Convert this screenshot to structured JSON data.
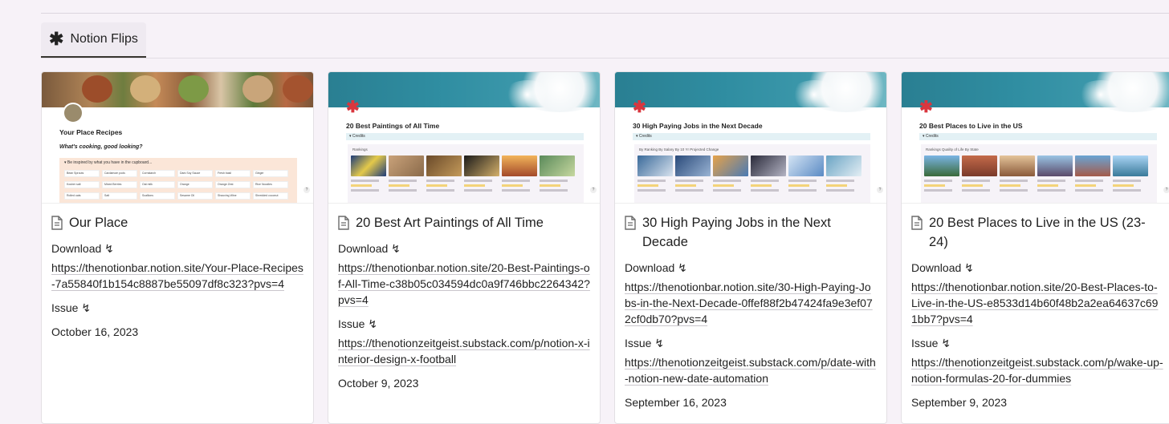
{
  "tab": {
    "icon": "asterisk-icon",
    "label": "Notion Flips"
  },
  "cards": [
    {
      "cover_type": "recipes",
      "cover_title": "Your Place Recipes",
      "cover_subtitle": "What's cooking, good looking?",
      "cover_box_title": "▾ Be inspired by what you have in the cupboard...",
      "cover_ingredients": [
        "Bean Sprouts",
        "Cardamom pods",
        "Cornstarch",
        "Dark Soy Sauce",
        "Fresh basil",
        "Ginger",
        "Kosher salt",
        "Mixed Berries",
        "Oat milk",
        "Orange",
        "Orange Zest",
        "Rice Noodles",
        "Rolled oats",
        "Salt",
        "Scallions",
        "Sesame Oil",
        "Shaoxing Wine",
        "Shredded coconut"
      ],
      "title": "Our Place",
      "download_label": "Download ↯",
      "download_url": "https://thenotionbar.notion.site/Your-Place-Recipes-7a55840f1b154c8887be55097df8c323?pvs=4",
      "issue_label": "Issue ↯",
      "issue_url": "",
      "date": "October 16, 2023"
    },
    {
      "cover_type": "database",
      "cover_title": "20 Best Paintings of All Time",
      "cover_credits": "▾ Credits",
      "cover_tabs": "Rankings",
      "title": "20 Best Art Paintings of All Time",
      "download_label": "Download ↯",
      "download_url": "https://thenotionbar.notion.site/20-Best-Paintings-of-All-Time-c38b05c034594dc0a9f746bbc2264342?pvs=4",
      "issue_label": "Issue ↯",
      "issue_url": "https://thenotionzeitgeist.substack.com/p/notion-x-interior-design-x-football",
      "date": "October 9, 2023"
    },
    {
      "cover_type": "database",
      "cover_title": "30 High Paying Jobs in the Next Decade",
      "cover_credits": "▾ Credits",
      "cover_tabs": "By Ranking   By Salary   By 10 Yr Projected Change",
      "title": "30 High Paying Jobs in the Next Decade",
      "download_label": "Download ↯",
      "download_url": "https://thenotionbar.notion.site/30-High-Paying-Jobs-in-the-Next-Decade-0ffef88f2b47424fa9e3ef072cf0db70?pvs=4",
      "issue_label": "Issue ↯",
      "issue_url": "https://thenotionzeitgeist.substack.com/p/date-with-notion-new-date-automation",
      "date": "September 16, 2023"
    },
    {
      "cover_type": "database",
      "cover_title": "20 Best Places to Live in the US",
      "cover_credits": "▾ Credits",
      "cover_tabs": "Rankings   Quality of Life   By State",
      "title": "20 Best Places to Live in the US (23-24)",
      "download_label": "Download ↯",
      "download_url": "https://thenotionbar.notion.site/20-Best-Places-to-Live-in-the-US-e8533d14b60f48b2a2ea64637c691bb7?pvs=4",
      "issue_label": "Issue ↯",
      "issue_url": "https://thenotionzeitgeist.substack.com/p/wake-up-notion-formulas-20-for-dummies",
      "date": "September 9, 2023"
    }
  ],
  "colors": {
    "background": "#f7f2f8",
    "accent_star": "#d9363e",
    "sea": "#2f8da1"
  }
}
